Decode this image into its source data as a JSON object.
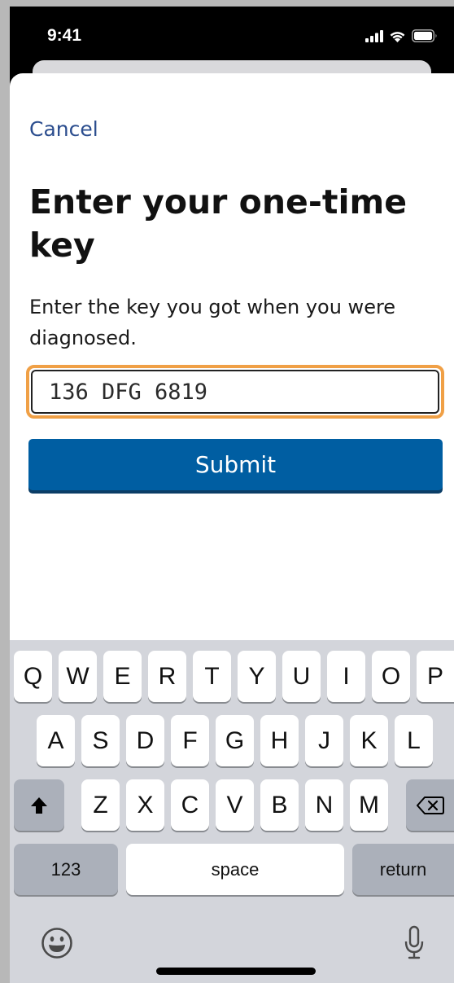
{
  "status_bar": {
    "time": "9:41",
    "icons": [
      "signal-icon",
      "wifi-icon",
      "battery-icon"
    ]
  },
  "sheet": {
    "cancel_label": "Cancel",
    "title": "Enter your one-time key",
    "instruction": "Enter the key you got when you were diagnosed.",
    "key_input_value": "136 DFG 6819",
    "submit_label": "Submit"
  },
  "keyboard": {
    "row1": [
      "Q",
      "W",
      "E",
      "R",
      "T",
      "Y",
      "U",
      "I",
      "O",
      "P"
    ],
    "row2": [
      "A",
      "S",
      "D",
      "F",
      "G",
      "H",
      "J",
      "K",
      "L"
    ],
    "row3": [
      "Z",
      "X",
      "C",
      "V",
      "B",
      "N",
      "M"
    ],
    "shift_icon": "shift-icon",
    "delete_icon": "backspace-icon",
    "numbers_label": "123",
    "space_label": "space",
    "return_label": "return",
    "emoji_icon": "emoji-icon",
    "dictation_icon": "microphone-icon"
  },
  "colors": {
    "link": "#2b4d8e",
    "primary_button": "#005ea2",
    "focus_ring": "#f0a046",
    "keyboard_bg": "#d3d5db"
  }
}
